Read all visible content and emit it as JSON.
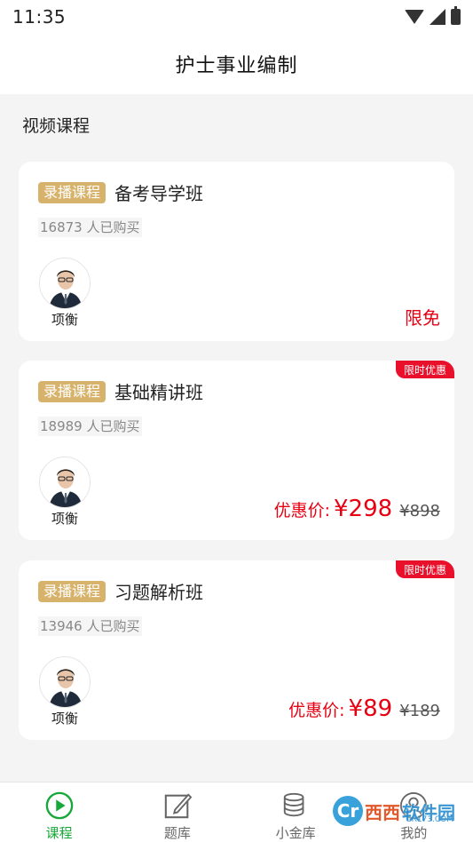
{
  "status_bar": {
    "time": "11:35"
  },
  "header": {
    "title": "护士事业编制"
  },
  "section": {
    "title": "视频课程"
  },
  "courses": [
    {
      "tag": "录播课程",
      "name": "备考导学班",
      "buyers": "16873 人已购买",
      "teacher": "项衡",
      "price_free": "限免"
    },
    {
      "ribbon": "限时优惠",
      "tag": "录播课程",
      "name": "基础精讲班",
      "buyers": "18989 人已购买",
      "teacher": "项衡",
      "price_label": "优惠价:",
      "price": "¥298",
      "original_price": "¥898"
    },
    {
      "ribbon": "限时优惠",
      "tag": "录播课程",
      "name": "习题解析班",
      "buyers": "13946 人已购买",
      "teacher": "项衡",
      "price_label": "优惠价:",
      "price": "¥89",
      "original_price": "¥189"
    }
  ],
  "tabs": [
    {
      "label": "课程",
      "icon": "play-circle-icon",
      "active": true
    },
    {
      "label": "题库",
      "icon": "edit-note-icon",
      "active": false
    },
    {
      "label": "小金库",
      "icon": "coins-stack-icon",
      "active": false
    },
    {
      "label": "我的",
      "icon": "user-icon",
      "active": false
    }
  ],
  "watermark": {
    "mark": "西西",
    "text": "软件园",
    "site": "CR173.COM"
  },
  "colors": {
    "accent_green": "#18a83a",
    "price_red": "#e60012",
    "tag_gold": "#d7b26b",
    "ribbon_red": "#e8102b"
  }
}
